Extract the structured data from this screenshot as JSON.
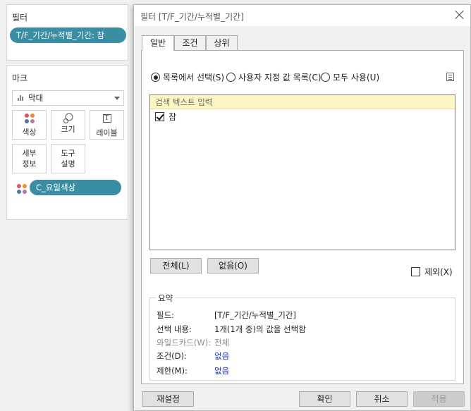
{
  "sidebar": {
    "filters": {
      "title": "필터",
      "pill": "T/F_기간/누적별_기간: 참"
    },
    "marks": {
      "title": "마크",
      "mark_type": "막대",
      "buttons": {
        "color": "색상",
        "size": "크기",
        "label": "레이블",
        "detail": "세부\n정보",
        "detail_line1": "세부",
        "detail_line2": "정보",
        "tooltip_line1": "도구",
        "tooltip_line2": "설명"
      },
      "label_icon_glyph": "T",
      "color_pill": "C_요일색상"
    }
  },
  "dialog": {
    "title": "필터 [T/F_기간/누적별_기간]",
    "tabs": [
      {
        "label": "일반",
        "active": true
      },
      {
        "label": "조건",
        "active": false
      },
      {
        "label": "상위",
        "active": false
      }
    ],
    "radios": [
      {
        "label": "목록에서 선택(S)",
        "checked": true
      },
      {
        "label": "사용자 지정 값 목록(C)",
        "checked": false
      },
      {
        "label": "모두 사용(U)",
        "checked": false
      }
    ],
    "search_placeholder": "검색 텍스트 입력",
    "items": [
      {
        "label": "참",
        "checked": true
      }
    ],
    "all_button": "전체(L)",
    "none_button": "없음(O)",
    "exclude_label": "제외(X)",
    "exclude_checked": false,
    "summary": {
      "legend": "요약",
      "rows": [
        {
          "key": "필드:",
          "value": "[T/F_기간/누적별_기간]"
        },
        {
          "key": "선택 내용:",
          "value": "1개(1개 중)의 값을 선택함"
        },
        {
          "key": "와일드카드(W):",
          "value": "전체"
        },
        {
          "key": "조건(D):",
          "value": "없음"
        },
        {
          "key": "제한(M):",
          "value": "없음"
        }
      ]
    },
    "footer": {
      "reset": "재설정",
      "ok": "확인",
      "cancel": "취소",
      "apply": "적용"
    }
  },
  "colors": {
    "pill": "#3a8ea4",
    "search_bg": "#fdf6c3",
    "link": "#1a2fb0"
  }
}
